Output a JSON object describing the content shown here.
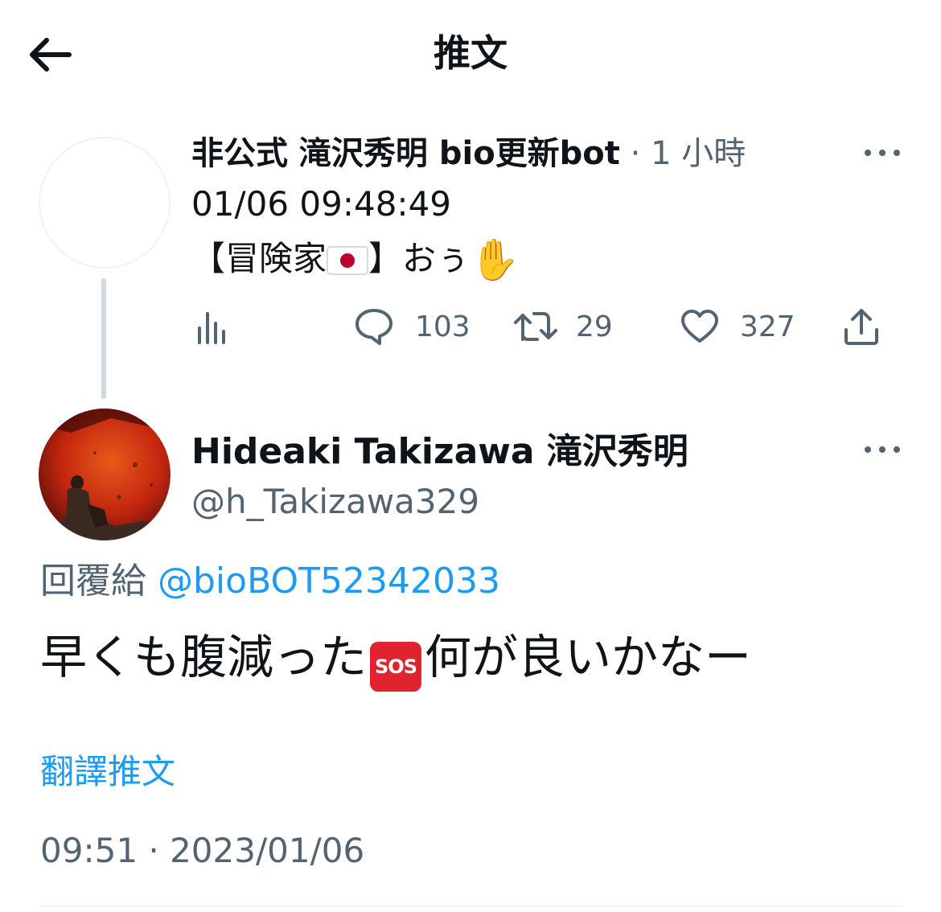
{
  "header": {
    "title": "推文",
    "back_icon": "arrow-left-icon"
  },
  "parent_tweet": {
    "display_name": "非公式 滝沢秀明 bio更新bot",
    "separator": "·",
    "relative_time": "1 小時",
    "line1": "01/06 09:48:49",
    "line2_open": "【冒険家",
    "line2_flag": "japan-flag-emoji",
    "line2_close": "】おぅ",
    "line2_emoji": "waving-hand-emoji",
    "metrics": {
      "views_icon": "analytics-icon",
      "replies": "103",
      "retweets": "29",
      "likes": "327",
      "share_icon": "share-icon"
    }
  },
  "main_tweet": {
    "display_name": "Hideaki Takizawa 滝沢秀明",
    "handle": "@h_Takizawa329",
    "reply_label": "回覆給",
    "reply_to": "@bioBOT52342033",
    "text_before": "早くも腹減った",
    "sos_emoji": "SOS",
    "text_after": "何が良いかなー",
    "translate_label": "翻譯推文",
    "timestamp": "09:51 · 2023/01/06"
  },
  "colors": {
    "text_primary": "#0f1419",
    "text_secondary": "#536471",
    "link": "#1d9bf0",
    "divider": "#eff3f4",
    "thread_line": "#cfd9de"
  }
}
